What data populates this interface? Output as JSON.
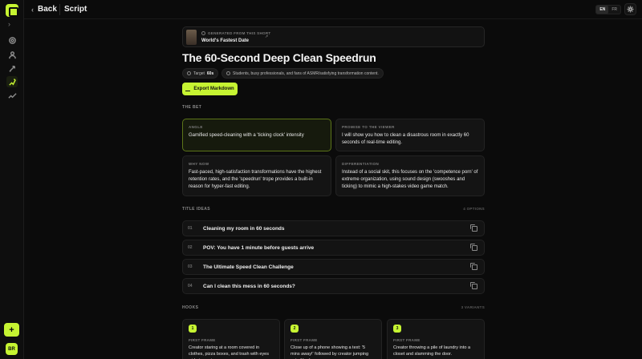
{
  "header": {
    "back_label": "Back",
    "page_label": "Script",
    "languages": [
      "EN",
      "FR"
    ],
    "active_language": "EN"
  },
  "source": {
    "kicker": "GENERATED FROM THIS SHORT",
    "title": "World's Fastest Date"
  },
  "script": {
    "title": "The 60-Second Deep Clean Speedrun",
    "target_label": "Target",
    "target_value": "60s",
    "audience": "Students, busy professionals, and fans of ASMR/satisfying transformation content.",
    "export_label": "Export Markdown"
  },
  "bet": {
    "section_label": "THE BET",
    "cards": [
      {
        "label": "ANGLE",
        "text": "Gamified speed-cleaning with a 'ticking clock' intensity"
      },
      {
        "label": "PROMISE TO THE VIEWER",
        "text": "I will show you how to clean a disastrous room in exactly 60 seconds of real-time editing."
      },
      {
        "label": "WHY NOW",
        "text": "Fast-paced, high-satisfaction transformations have the highest retention rates, and the 'speedrun' trope provides a built-in reason for hyper-fast editing."
      },
      {
        "label": "DIFFERENTIATION",
        "text": "Instead of a social skit, this focuses on the 'competence porn' of extreme organization, using sound design (swooshes and ticking) to mimic a high-stakes video game match."
      }
    ]
  },
  "titles": {
    "section_label": "TITLE IDEAS",
    "count_label": "4 OPTIONS",
    "items": [
      {
        "num": "01",
        "text": "Cleaning my room in 60 seconds"
      },
      {
        "num": "02",
        "text": "POV: You have 1 minute before guests arrive"
      },
      {
        "num": "03",
        "text": "The Ultimate Speed Clean Challenge"
      },
      {
        "num": "04",
        "text": "Can I clean this mess in 60 seconds?"
      }
    ]
  },
  "hooks": {
    "section_label": "HOOKS",
    "count_label": "3 VARIANTS",
    "items": [
      {
        "num": "1",
        "label": "FIRST FRAME",
        "text": "Creator staring at a room covered in clothes, pizza boxes, and trash with eyes wide in panic."
      },
      {
        "num": "2",
        "label": "FIRST FRAME",
        "text": "Close up of a phone showing a text: '5 mins away!' followed by creator jumping out of bed."
      },
      {
        "num": "3",
        "label": "FIRST FRAME",
        "text": "Creator throwing a pile of laundry into a closet and slamming the door."
      }
    ]
  },
  "rail": {
    "avatar_initials": "BR",
    "icons": [
      "home-icon",
      "users-icon",
      "rocket-icon",
      "script-icon",
      "analytics-icon"
    ]
  }
}
